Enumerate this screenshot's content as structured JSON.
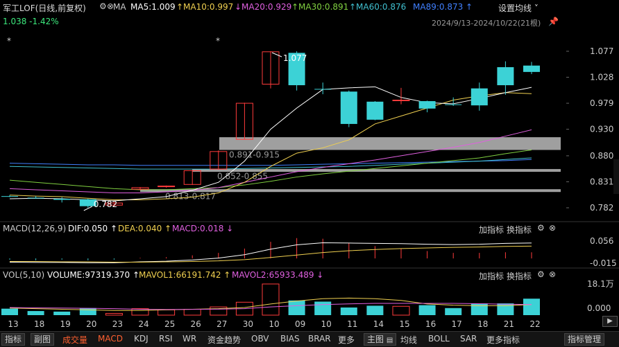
{
  "header": {
    "title": "军工LOF(日线,前复权)",
    "ma_label": "MA",
    "ma5": "MA5:1.009",
    "ma10": "↑MA10:0.997",
    "ma20": "↓MA20:0.929",
    "ma30": "↑MA30:0.891",
    "ma60": "↑MA60:0.876",
    "ma89": "MA89:0.873 ↑",
    "ma_colors": {
      "ma5": "#ffffff",
      "ma10": "#f0d050",
      "ma20": "#e060e0",
      "ma30": "#80d040",
      "ma60": "#40c0d0",
      "ma89": "#4080ff"
    },
    "settings_label": "设置均线",
    "price_change": "1.038 -1.42%",
    "date_range": "2024/9/13-2024/10/22(21根)"
  },
  "chart_data": {
    "type": "candlestick",
    "dates": [
      "13",
      "18",
      "19",
      "20",
      "23",
      "24",
      "25",
      "26",
      "27",
      "30",
      "10",
      "09",
      "10",
      "11",
      "14",
      "15",
      "16",
      "17",
      "18",
      "21",
      "22"
    ],
    "candles": [
      {
        "o": 0.804,
        "h": 0.806,
        "l": 0.802,
        "c": 0.803
      },
      {
        "o": 0.801,
        "h": 0.804,
        "l": 0.799,
        "c": 0.8
      },
      {
        "o": 0.799,
        "h": 0.802,
        "l": 0.792,
        "c": 0.797
      },
      {
        "o": 0.798,
        "h": 0.799,
        "l": 0.782,
        "c": 0.785
      },
      {
        "o": 0.787,
        "h": 0.793,
        "l": 0.784,
        "c": 0.791
      },
      {
        "o": 0.817,
        "h": 0.821,
        "l": 0.815,
        "c": 0.82
      },
      {
        "o": 0.822,
        "h": 0.824,
        "l": 0.82,
        "c": 0.823
      },
      {
        "o": 0.826,
        "h": 0.853,
        "l": 0.825,
        "c": 0.852
      },
      {
        "o": 0.855,
        "h": 0.89,
        "l": 0.854,
        "c": 0.888
      },
      {
        "o": 0.911,
        "h": 0.98,
        "l": 0.911,
        "c": 0.979
      },
      {
        "o": 1.015,
        "h": 1.077,
        "l": 1.007,
        "c": 1.076
      },
      {
        "o": 1.074,
        "h": 1.077,
        "l": 1.003,
        "c": 1.013
      },
      {
        "o": 1.006,
        "h": 1.018,
        "l": 0.996,
        "c": 1.005
      },
      {
        "o": 1.001,
        "h": 1.003,
        "l": 0.934,
        "c": 0.94
      },
      {
        "o": 0.982,
        "h": 0.983,
        "l": 0.947,
        "c": 0.948
      },
      {
        "o": 0.984,
        "h": 1.008,
        "l": 0.977,
        "c": 0.985
      },
      {
        "o": 0.983,
        "h": 0.984,
        "l": 0.962,
        "c": 0.969
      },
      {
        "o": 0.977,
        "h": 0.99,
        "l": 0.974,
        "c": 0.976
      },
      {
        "o": 1.007,
        "h": 1.018,
        "l": 0.965,
        "c": 0.975
      },
      {
        "o": 1.047,
        "h": 1.058,
        "l": 0.995,
        "c": 1.013
      },
      {
        "o": 1.05,
        "h": 1.057,
        "l": 1.034,
        "c": 1.038
      }
    ],
    "ma5": [
      0.799,
      0.8,
      0.799,
      0.797,
      0.795,
      0.799,
      0.803,
      0.815,
      0.83,
      0.87,
      0.93,
      0.97,
      1.005,
      1.008,
      1.01,
      0.99,
      0.98,
      0.978,
      0.988,
      0.999,
      1.009
    ],
    "ma10": [
      0.806,
      0.804,
      0.803,
      0.8,
      0.797,
      0.797,
      0.799,
      0.802,
      0.81,
      0.83,
      0.86,
      0.885,
      0.895,
      0.91,
      0.94,
      0.955,
      0.97,
      0.985,
      0.993,
      0.999,
      0.997
    ],
    "ma20": [
      0.818,
      0.816,
      0.814,
      0.812,
      0.81,
      0.81,
      0.812,
      0.815,
      0.82,
      0.83,
      0.84,
      0.85,
      0.858,
      0.865,
      0.872,
      0.88,
      0.888,
      0.896,
      0.905,
      0.917,
      0.929
    ],
    "ma30": [
      0.834,
      0.83,
      0.826,
      0.822,
      0.818,
      0.816,
      0.816,
      0.818,
      0.82,
      0.825,
      0.832,
      0.84,
      0.846,
      0.851,
      0.856,
      0.861,
      0.866,
      0.871,
      0.876,
      0.884,
      0.891
    ],
    "ma60": [
      0.86,
      0.859,
      0.858,
      0.857,
      0.856,
      0.855,
      0.855,
      0.855,
      0.855,
      0.856,
      0.857,
      0.858,
      0.859,
      0.86,
      0.862,
      0.864,
      0.866,
      0.868,
      0.87,
      0.873,
      0.876
    ],
    "ma89": [
      0.866,
      0.865,
      0.864,
      0.863,
      0.863,
      0.862,
      0.862,
      0.862,
      0.862,
      0.862,
      0.862,
      0.863,
      0.864,
      0.865,
      0.866,
      0.867,
      0.868,
      0.869,
      0.87,
      0.871,
      0.873
    ],
    "y_ticks": [
      "1.077",
      "1.028",
      "0.979",
      "0.930",
      "0.880",
      "0.831",
      "0.782"
    ],
    "ylim": [
      0.782,
      1.077
    ],
    "annotations": {
      "high": "1.077",
      "low": "0.782"
    },
    "zones": [
      {
        "label": "0.891-0.915",
        "lo": 0.891,
        "hi": 0.915
      },
      {
        "label": "0.852-0.855",
        "lo": 0.852,
        "hi": 0.855
      },
      {
        "label": "0.813-0.817",
        "lo": 0.813,
        "hi": 0.817
      }
    ],
    "macd": {
      "dif": [
        -0.012,
        -0.013,
        -0.013,
        -0.014,
        -0.014,
        -0.011,
        -0.009,
        -0.005,
        0.001,
        0.012,
        0.03,
        0.044,
        0.051,
        0.05,
        0.049,
        0.048,
        0.046,
        0.045,
        0.046,
        0.049,
        0.05
      ],
      "dea": [
        -0.01,
        -0.01,
        -0.011,
        -0.011,
        -0.012,
        -0.012,
        -0.011,
        -0.01,
        -0.008,
        -0.004,
        0.003,
        0.011,
        0.019,
        0.025,
        0.029,
        0.032,
        0.034,
        0.036,
        0.037,
        0.039,
        0.04
      ],
      "hist": [
        -0.004,
        -0.006,
        -0.004,
        -0.006,
        -0.004,
        0.002,
        0.004,
        0.01,
        0.018,
        0.032,
        0.054,
        0.066,
        0.064,
        0.05,
        0.04,
        0.032,
        0.024,
        0.018,
        0.018,
        0.02,
        0.02
      ],
      "y_ticks": [
        "0.056",
        "-0.015"
      ]
    },
    "volume": {
      "values": [
        5.5,
        3.5,
        3.0,
        6.0,
        1.5,
        5.5,
        4.5,
        5.0,
        7.0,
        11.0,
        26.5,
        12.5,
        11.5,
        6.5,
        8.0,
        7.5,
        8.5,
        6.0,
        10.0,
        10.0,
        14.0
      ],
      "mavol1": [
        6.0,
        5.5,
        5.0,
        4.5,
        4.0,
        4.0,
        4.5,
        5.0,
        5.5,
        6.5,
        9.5,
        12.0,
        14.0,
        14.5,
        14.0,
        12.5,
        9.5,
        8.5,
        8.0,
        8.0,
        9.0
      ],
      "mavol2": [
        6.5,
        6.2,
        6.0,
        5.8,
        5.5,
        5.0,
        4.8,
        4.9,
        5.1,
        5.5,
        7.0,
        8.0,
        9.0,
        9.6,
        10.0,
        10.0,
        10.0,
        10.0,
        9.7,
        9.3,
        9.0
      ],
      "y_ticks": [
        "18.1万",
        "0.000"
      ]
    },
    "candle_colors": {
      "up": "#ff3b3b",
      "down": "#3cd2d6"
    }
  },
  "macd_header": {
    "label": "MACD(12,26,9)",
    "dif": "DIF:0.050 ↑",
    "dea": "DEA:0.040 ↑",
    "macd": "MACD:0.018 ↓",
    "add": "加指标",
    "switch": "换指标"
  },
  "vol_header": {
    "label": "VOL(5,10)",
    "volume": "VOLUME:97319.370 ↑",
    "mavol1": "MAVOL1:66191.742 ↑",
    "mavol2": "MAVOL2:65933.489 ↓",
    "add": "加指标",
    "switch": "换指标"
  },
  "bottom_bar": {
    "left": [
      "指标",
      "副图"
    ],
    "items": [
      "成交量",
      "MACD",
      "KDJ",
      "RSI",
      "WR",
      "资金趋势",
      "OBV",
      "BIAS",
      "BRAR",
      "更多"
    ],
    "main_label": "主图",
    "main_items": [
      "均线",
      "BOLL",
      "SAR",
      "更多指标"
    ],
    "manage": "指标管理"
  },
  "stars": [
    "*",
    "*"
  ]
}
